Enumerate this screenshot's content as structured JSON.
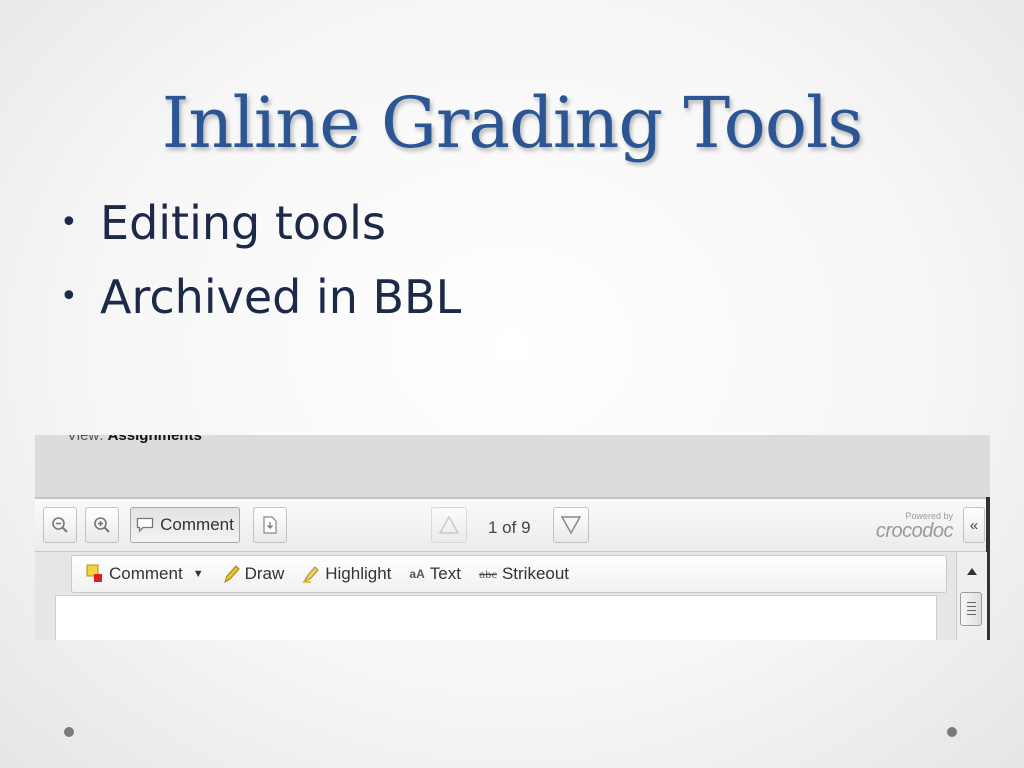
{
  "slide": {
    "title": "Inline Grading Tools",
    "bullets": [
      "Editing tools",
      "Archived in BBL"
    ],
    "bullet_glyph": "•"
  },
  "screenshot": {
    "view_label": "View:",
    "view_value": "Assignments",
    "toolbar": {
      "zoom_out_icon": "zoom-out-icon",
      "zoom_in_icon": "zoom-in-icon",
      "comment_label": "Comment",
      "download_icon": "download-icon",
      "page_info": "1 of 9",
      "powered_by": "Powered by",
      "brand_name": "crocodoc",
      "collapse_label": "«"
    },
    "annotation_tools": {
      "comment": "Comment",
      "draw": "Draw",
      "highlight": "Highlight",
      "text": "Text",
      "strikeout": "Strikeout"
    }
  },
  "colors": {
    "title": "#2b5593",
    "body_text": "#1c2a48",
    "comment_marker": "#e02020",
    "highlight_marker": "#e8c530"
  }
}
